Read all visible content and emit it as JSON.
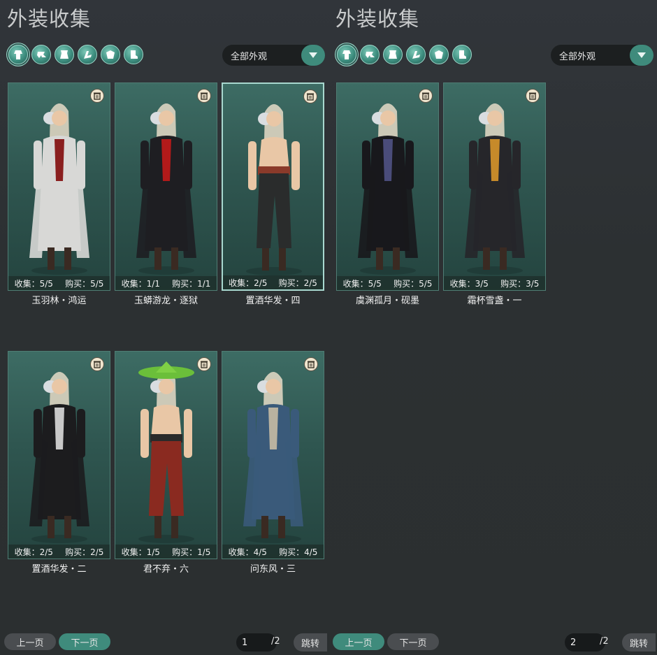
{
  "colors": {
    "accent": "#3f8b7c",
    "card_bg": "#2f5650",
    "text": "#f2f2f2"
  },
  "filter_icons": [
    "all-outfit-icon",
    "head-icon",
    "top-icon",
    "pants-icon",
    "gloves-icon",
    "shoes-icon"
  ],
  "panels": [
    {
      "title": "外装收集",
      "dropdown": {
        "selected": "全部外观"
      },
      "cards": [
        {
          "name": "玉羽林・鸿运",
          "collect": "收集：5/5",
          "buy": "购买：5/5",
          "outfit": "#d8d8d6",
          "accent": "#8a1f1f",
          "selected": false
        },
        {
          "name": "玉蟒游龙・逐狱",
          "collect": "收集：1/1",
          "buy": "购买：1/1",
          "outfit": "#1e1e22",
          "accent": "#b21a1a",
          "selected": false
        },
        {
          "name": "置酒华发・四",
          "collect": "收集：2/5",
          "buy": "购买：2/5",
          "outfit": "#2a2c2c",
          "accent": "#8a3a2a",
          "selected": true,
          "bare": true
        },
        {
          "name": "置酒华发・二",
          "collect": "收集：2/5",
          "buy": "购买：2/5",
          "outfit": "#1c1c1e",
          "accent": "#c8c8c8",
          "selected": false
        },
        {
          "name": "君不弃・六",
          "collect": "收集：1/5",
          "buy": "购买：1/5",
          "outfit": "#8a2a20",
          "accent": "#2a2a2a",
          "selected": false,
          "bare": true,
          "hat": true
        },
        {
          "name": "问东风・三",
          "collect": "收集：4/5",
          "buy": "购买：4/5",
          "outfit": "#3a5a7a",
          "accent": "#b9b2a0",
          "selected": false
        }
      ],
      "pager": {
        "prev": "上一页",
        "next": "下一页",
        "page": "1",
        "total": "/2",
        "jump": "跳转"
      }
    },
    {
      "title": "外装收集",
      "dropdown": {
        "selected": "全部外观"
      },
      "cards": [
        {
          "name": "虞渊孤月・砚墨",
          "collect": "收集：5/5",
          "buy": "购买：5/5",
          "outfit": "#18181c",
          "accent": "#4a4c7a",
          "selected": false
        },
        {
          "name": "霜杯雪盏・一",
          "collect": "收集：3/5",
          "buy": "购买：3/5",
          "outfit": "#26262a",
          "accent": "#c68a2a",
          "selected": false
        }
      ],
      "pager": {
        "prev": "上一页",
        "next": "下一页",
        "page": "2",
        "total": "/2",
        "jump": "跳转"
      }
    }
  ]
}
